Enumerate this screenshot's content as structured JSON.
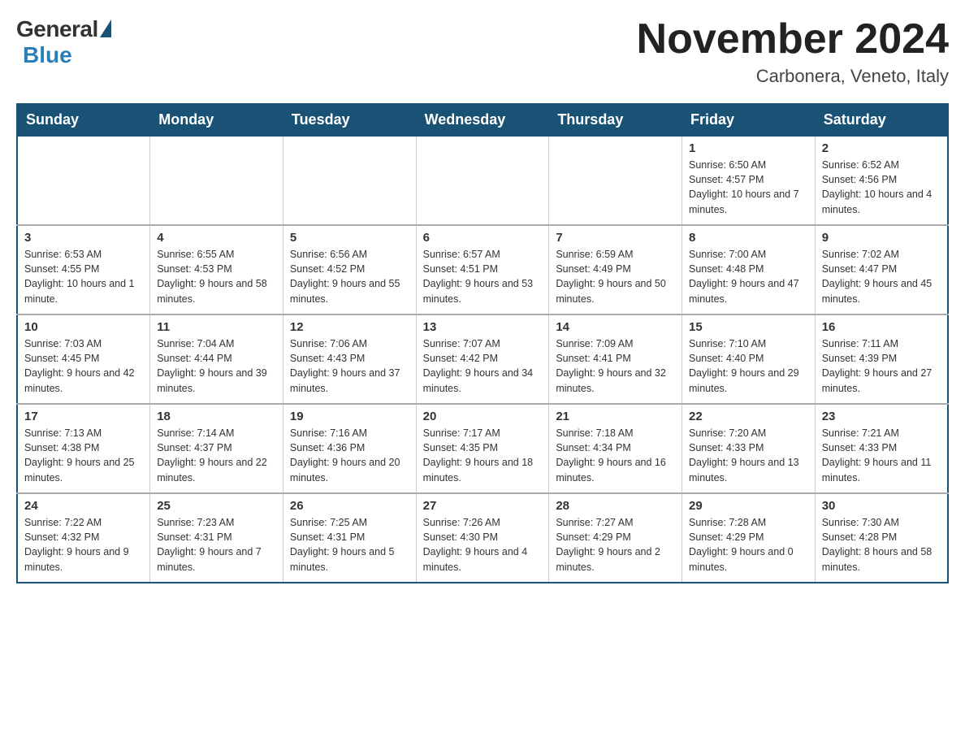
{
  "header": {
    "logo": {
      "general": "General",
      "blue": "Blue"
    },
    "title": "November 2024",
    "location": "Carbonera, Veneto, Italy"
  },
  "days_of_week": [
    "Sunday",
    "Monday",
    "Tuesday",
    "Wednesday",
    "Thursday",
    "Friday",
    "Saturday"
  ],
  "weeks": [
    [
      {
        "day": "",
        "info": ""
      },
      {
        "day": "",
        "info": ""
      },
      {
        "day": "",
        "info": ""
      },
      {
        "day": "",
        "info": ""
      },
      {
        "day": "",
        "info": ""
      },
      {
        "day": "1",
        "info": "Sunrise: 6:50 AM\nSunset: 4:57 PM\nDaylight: 10 hours and 7 minutes."
      },
      {
        "day": "2",
        "info": "Sunrise: 6:52 AM\nSunset: 4:56 PM\nDaylight: 10 hours and 4 minutes."
      }
    ],
    [
      {
        "day": "3",
        "info": "Sunrise: 6:53 AM\nSunset: 4:55 PM\nDaylight: 10 hours and 1 minute."
      },
      {
        "day": "4",
        "info": "Sunrise: 6:55 AM\nSunset: 4:53 PM\nDaylight: 9 hours and 58 minutes."
      },
      {
        "day": "5",
        "info": "Sunrise: 6:56 AM\nSunset: 4:52 PM\nDaylight: 9 hours and 55 minutes."
      },
      {
        "day": "6",
        "info": "Sunrise: 6:57 AM\nSunset: 4:51 PM\nDaylight: 9 hours and 53 minutes."
      },
      {
        "day": "7",
        "info": "Sunrise: 6:59 AM\nSunset: 4:49 PM\nDaylight: 9 hours and 50 minutes."
      },
      {
        "day": "8",
        "info": "Sunrise: 7:00 AM\nSunset: 4:48 PM\nDaylight: 9 hours and 47 minutes."
      },
      {
        "day": "9",
        "info": "Sunrise: 7:02 AM\nSunset: 4:47 PM\nDaylight: 9 hours and 45 minutes."
      }
    ],
    [
      {
        "day": "10",
        "info": "Sunrise: 7:03 AM\nSunset: 4:45 PM\nDaylight: 9 hours and 42 minutes."
      },
      {
        "day": "11",
        "info": "Sunrise: 7:04 AM\nSunset: 4:44 PM\nDaylight: 9 hours and 39 minutes."
      },
      {
        "day": "12",
        "info": "Sunrise: 7:06 AM\nSunset: 4:43 PM\nDaylight: 9 hours and 37 minutes."
      },
      {
        "day": "13",
        "info": "Sunrise: 7:07 AM\nSunset: 4:42 PM\nDaylight: 9 hours and 34 minutes."
      },
      {
        "day": "14",
        "info": "Sunrise: 7:09 AM\nSunset: 4:41 PM\nDaylight: 9 hours and 32 minutes."
      },
      {
        "day": "15",
        "info": "Sunrise: 7:10 AM\nSunset: 4:40 PM\nDaylight: 9 hours and 29 minutes."
      },
      {
        "day": "16",
        "info": "Sunrise: 7:11 AM\nSunset: 4:39 PM\nDaylight: 9 hours and 27 minutes."
      }
    ],
    [
      {
        "day": "17",
        "info": "Sunrise: 7:13 AM\nSunset: 4:38 PM\nDaylight: 9 hours and 25 minutes."
      },
      {
        "day": "18",
        "info": "Sunrise: 7:14 AM\nSunset: 4:37 PM\nDaylight: 9 hours and 22 minutes."
      },
      {
        "day": "19",
        "info": "Sunrise: 7:16 AM\nSunset: 4:36 PM\nDaylight: 9 hours and 20 minutes."
      },
      {
        "day": "20",
        "info": "Sunrise: 7:17 AM\nSunset: 4:35 PM\nDaylight: 9 hours and 18 minutes."
      },
      {
        "day": "21",
        "info": "Sunrise: 7:18 AM\nSunset: 4:34 PM\nDaylight: 9 hours and 16 minutes."
      },
      {
        "day": "22",
        "info": "Sunrise: 7:20 AM\nSunset: 4:33 PM\nDaylight: 9 hours and 13 minutes."
      },
      {
        "day": "23",
        "info": "Sunrise: 7:21 AM\nSunset: 4:33 PM\nDaylight: 9 hours and 11 minutes."
      }
    ],
    [
      {
        "day": "24",
        "info": "Sunrise: 7:22 AM\nSunset: 4:32 PM\nDaylight: 9 hours and 9 minutes."
      },
      {
        "day": "25",
        "info": "Sunrise: 7:23 AM\nSunset: 4:31 PM\nDaylight: 9 hours and 7 minutes."
      },
      {
        "day": "26",
        "info": "Sunrise: 7:25 AM\nSunset: 4:31 PM\nDaylight: 9 hours and 5 minutes."
      },
      {
        "day": "27",
        "info": "Sunrise: 7:26 AM\nSunset: 4:30 PM\nDaylight: 9 hours and 4 minutes."
      },
      {
        "day": "28",
        "info": "Sunrise: 7:27 AM\nSunset: 4:29 PM\nDaylight: 9 hours and 2 minutes."
      },
      {
        "day": "29",
        "info": "Sunrise: 7:28 AM\nSunset: 4:29 PM\nDaylight: 9 hours and 0 minutes."
      },
      {
        "day": "30",
        "info": "Sunrise: 7:30 AM\nSunset: 4:28 PM\nDaylight: 8 hours and 58 minutes."
      }
    ]
  ]
}
